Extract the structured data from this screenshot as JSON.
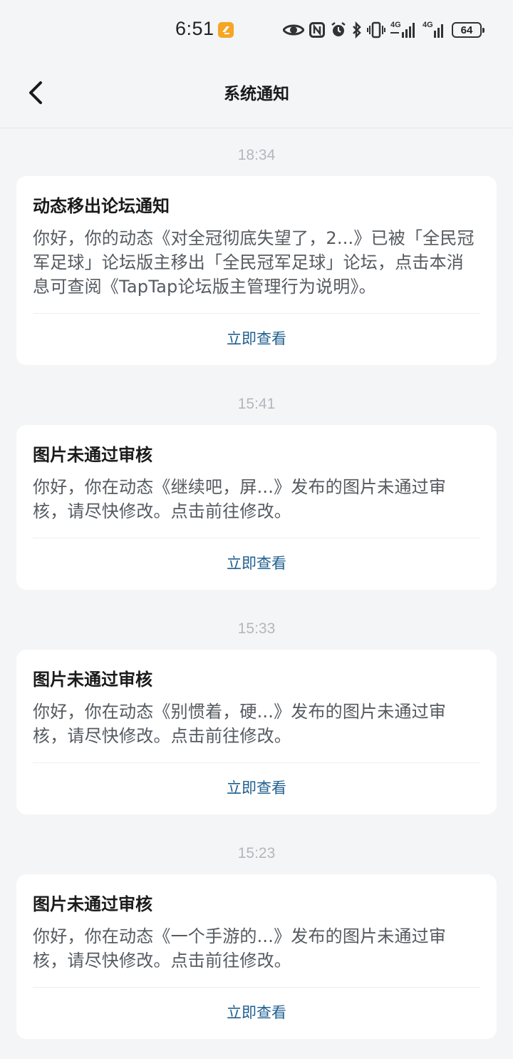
{
  "status_bar": {
    "time": "6:51",
    "app_badge_icon": "orange-app-notification-icon",
    "icons": [
      "eye-icon",
      "nfc-icon",
      "alarm-icon",
      "bluetooth-icon",
      "vibrate-icon",
      "signal-4g-icon",
      "signal-4g-icon"
    ],
    "signal_label_1": "4G",
    "signal_label_2": "4G",
    "battery_level": "64"
  },
  "header": {
    "title": "系统通知",
    "back_icon": "chevron-left-icon"
  },
  "colors": {
    "background": "#f4f5f7",
    "card": "#ffffff",
    "link": "#1f5f8f",
    "time": "#b3b7bd",
    "badge": "#f5a623"
  },
  "notifications": [
    {
      "time": "18:34",
      "title": "动态移出论坛通知",
      "body": "你好，你的动态《对全冠彻底失望了，2...》已被「全民冠军足球」论坛版主移出「全民冠军足球」论坛，点击本消息可查阅《TapTap论坛版主管理行为说明》。",
      "action": "立即查看"
    },
    {
      "time": "15:41",
      "title": "图片未通过审核",
      "body": "你好，你在动态《继续吧，屏...》发布的图片未通过审核，请尽快修改。点击前往修改。",
      "action": "立即查看"
    },
    {
      "time": "15:33",
      "title": "图片未通过审核",
      "body": "你好，你在动态《别惯着，硬...》发布的图片未通过审核，请尽快修改。点击前往修改。",
      "action": "立即查看"
    },
    {
      "time": "15:23",
      "title": "图片未通过审核",
      "body": "你好，你在动态《一个手游的...》发布的图片未通过审核，请尽快修改。点击前往修改。",
      "action": "立即查看"
    }
  ]
}
